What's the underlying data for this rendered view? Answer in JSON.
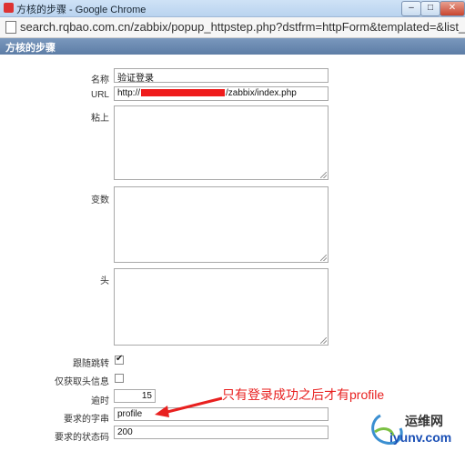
{
  "window": {
    "title": "方核的步骤 - Google Chrome",
    "url": "search.rqbao.com.cn/zabbix/popup_httpstep.php?dstfrm=httpForm&templated=&list_"
  },
  "panel": {
    "title": "方核的步骤"
  },
  "form": {
    "name_label": "名称",
    "name_value": "验证登录",
    "url_label": "URL",
    "url_prefix": "http://",
    "url_suffix": "/zabbix/index.php",
    "post_label": "粘上",
    "variables_label": "变数",
    "headers_label": "头",
    "follow_label": "跟随跳转",
    "follow_checked": true,
    "retrieve_label": "仅获取头信息",
    "retrieve_checked": false,
    "timeout_label": "逾时",
    "timeout_value": "15",
    "required_string_label": "要求的字串",
    "required_string_value": "profile",
    "status_codes_label": "要求的状态码",
    "status_codes_value": "200"
  },
  "annotation": {
    "text": "只有登录成功之后才有profile",
    "color": "#e8201f"
  },
  "watermark": {
    "line1": "运维网",
    "line2": "iyunv.com"
  }
}
